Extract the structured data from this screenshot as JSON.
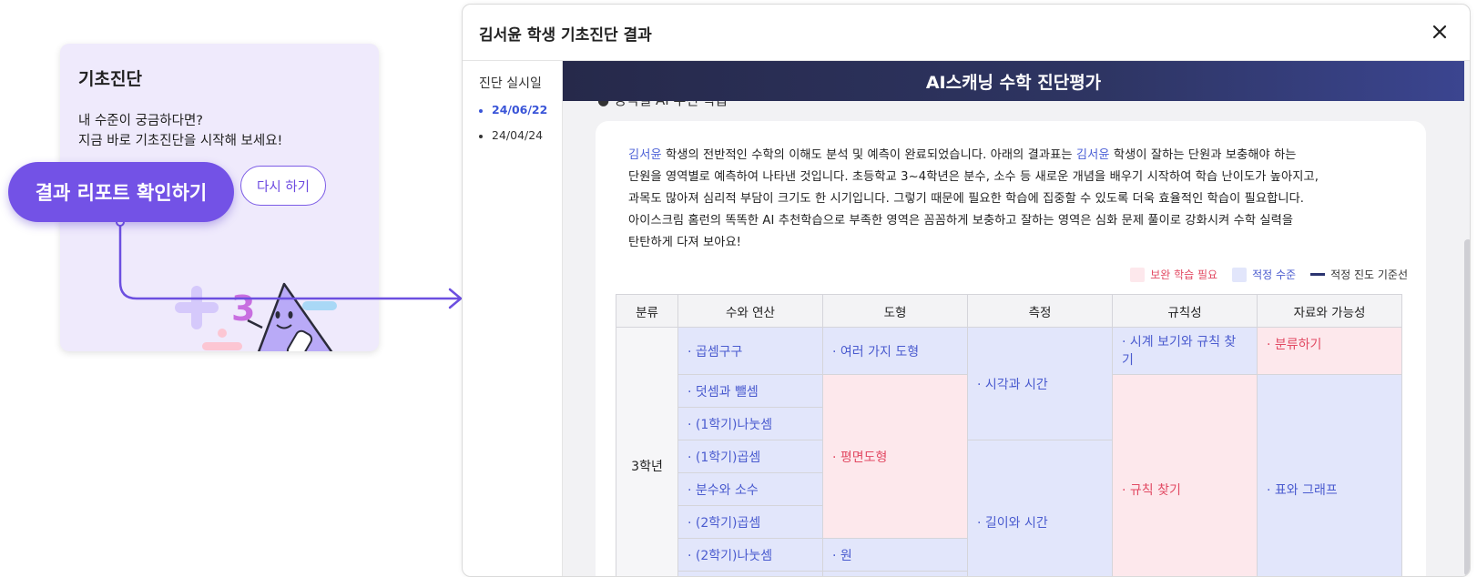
{
  "card": {
    "title": "기초진단",
    "desc_line1": "내 수준이 궁금하다면?",
    "desc_line2": "지금 바로 기초진단을 시작해 보세요!",
    "retry_label": "다시 하기",
    "result_label": "결과 리포트 확인하기"
  },
  "modal": {
    "title": "김서윤 학생 기초진단 결과",
    "close_icon": "close-icon",
    "side_title": "진단 실시일",
    "dates": [
      "24/06/22",
      "24/04/24"
    ],
    "banner": "AI스캐닝 수학 진단평가",
    "peek_text": "영역별 AI 추천 학습"
  },
  "report": {
    "name": "김서윤",
    "p1_after_name": " 학생의 전반적인 수학의 이해도 분석 및 예측이 완료되었습니다. 아래의 결과표는 ",
    "p1_after_name2": " 학생이 잘하는 단원과 보충해야 하는",
    "line2": "단원을 영역별로 예측하여 나타낸 것입니다. 초등학교 3~4학년은 분수, 소수 등 새로운 개념을 배우기 시작하여 학습 난이도가 높아지고,",
    "line3": "과목도 많아져 심리적 부담이 크기도 한 시기입니다. 그렇기 때문에 필요한 학습에 집중할 수 있도록 더욱 효율적인 학습이 필요합니다.",
    "line4": "아이스크림 홈런의 똑똑한 AI 추천학습으로 부족한 영역은 꼼꼼하게 보충하고 잘하는 영역은 심화 문제 풀이로 강화시켜 수학 실력을",
    "line5": "탄탄하게 다져 보아요!"
  },
  "legend": {
    "need_label": "보완 학습 필요",
    "ok_label": "적정 수준",
    "line_label": "적정 진도 기준선",
    "need_color": "#fde8ec",
    "ok_color": "#e2e6fb"
  },
  "table": {
    "headers": [
      "분류",
      "수와 연산",
      "도형",
      "측정",
      "규칙성",
      "자료와 가능성"
    ],
    "grade": "3학년",
    "numbers": [
      "곱셈구구",
      "덧셈과 뺄셈",
      "(1학기)나눗셈",
      "(1학기)곱셈",
      "분수와 소수",
      "(2학기)곱셈",
      "(2학기)나눗셈"
    ],
    "shapes": [
      "여러 가지 도형",
      "평면도형",
      "원"
    ],
    "measure": [
      "시각과 시간",
      "길이와 시간"
    ],
    "pattern": [
      "시계 보기와 규칙 찾기",
      "규칙 찾기"
    ],
    "data": [
      "분류하기",
      "표와 그래프"
    ]
  }
}
